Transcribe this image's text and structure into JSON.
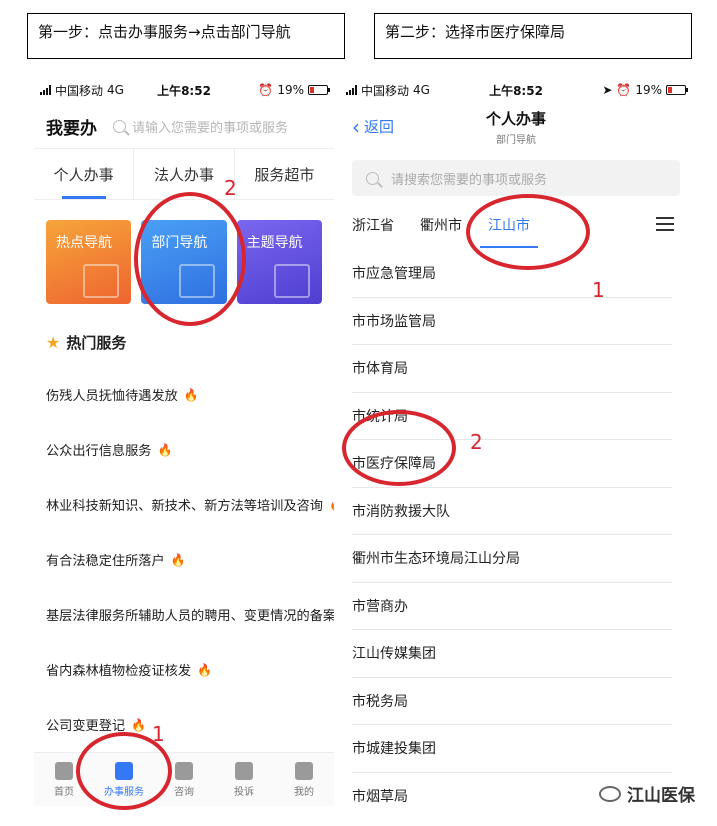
{
  "steps": {
    "step1": "第一步：点击办事服务→点击部门导航",
    "step2": "第二步：选择市医疗保障局"
  },
  "left": {
    "status": {
      "carrier": "中国移动",
      "network": "4G",
      "time": "上午8:52",
      "battery": "19%"
    },
    "header_title": "我要办",
    "search_placeholder": "请输入您需要的事项或服务",
    "tabs": [
      "个人办事",
      "法人办事",
      "服务超市"
    ],
    "nav_cards": [
      "热点导航",
      "部门导航",
      "主题导航"
    ],
    "hot_title": "热门服务",
    "services": [
      "伤残人员抚恤待遇发放",
      "公众出行信息服务",
      "林业科技新知识、新技术、新方法等培训及咨询",
      "有合法稳定住所落户",
      "基层法律服务所辅助人员的聘用、变更情况的备案",
      "省内森林植物检疫证核发",
      "公司变更登记"
    ],
    "tabbar": [
      "首页",
      "办事服务",
      "咨询",
      "投诉",
      "我的"
    ]
  },
  "right": {
    "status": {
      "carrier": "中国移动",
      "network": "4G",
      "time": "上午8:52",
      "battery": "19%"
    },
    "back": "返回",
    "title": "个人办事",
    "subtitle": "部门导航",
    "search_placeholder": "请搜索您需要的事项或服务",
    "regions": [
      "浙江省",
      "衢州市",
      "江山市"
    ],
    "departments": [
      "市应急管理局",
      "市市场监管局",
      "市体育局",
      "市统计局",
      "市医疗保障局",
      "市消防救援大队",
      "衢州市生态环境局江山分局",
      "市营商办",
      "江山传媒集团",
      "市税务局",
      "市城建投集团",
      "市烟草局"
    ]
  },
  "annotations": [
    "2",
    "1",
    "1",
    "2"
  ],
  "watermark": "江山医保",
  "colors": {
    "accent": "#3478f6",
    "annotation": "#d8262f"
  }
}
